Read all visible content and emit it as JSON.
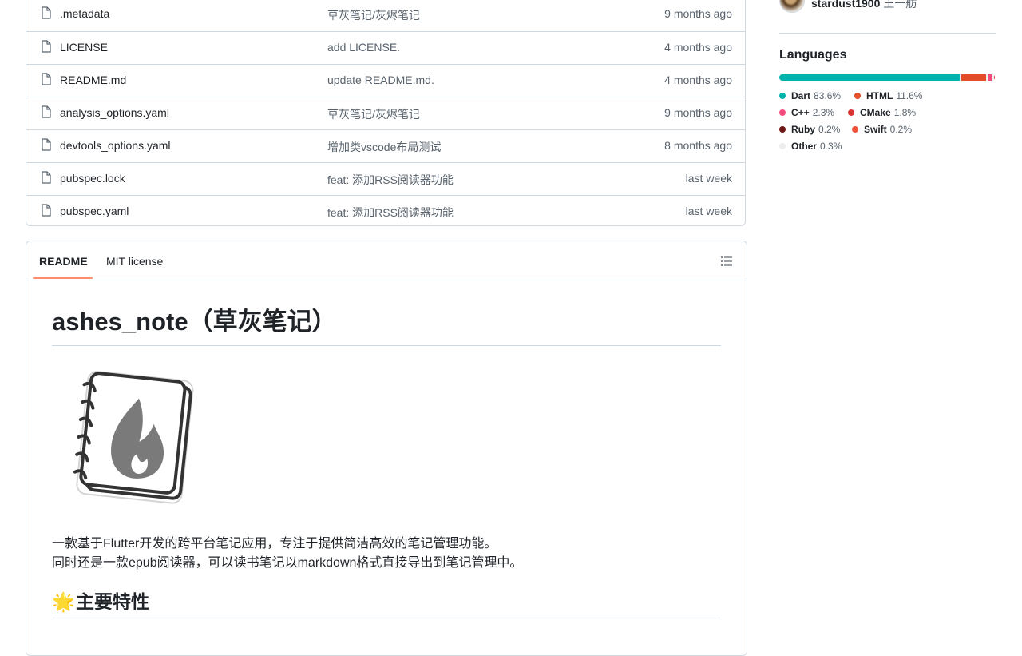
{
  "files": [
    {
      "name": ".metadata",
      "commit": "草灰笔记/灰烬笔记",
      "time": "9 months ago"
    },
    {
      "name": "LICENSE",
      "commit": "add LICENSE.",
      "time": "4 months ago"
    },
    {
      "name": "README.md",
      "commit": "update README.md.",
      "time": "4 months ago"
    },
    {
      "name": "analysis_options.yaml",
      "commit": "草灰笔记/灰烬笔记",
      "time": "9 months ago"
    },
    {
      "name": "devtools_options.yaml",
      "commit": "增加类vscode布局测试",
      "time": "8 months ago"
    },
    {
      "name": "pubspec.lock",
      "commit": "feat: 添加RSS阅读器功能",
      "time": "last week"
    },
    {
      "name": "pubspec.yaml",
      "commit": "feat: 添加RSS阅读器功能",
      "time": "last week"
    }
  ],
  "readme": {
    "tabs": {
      "readme": "README",
      "license": "MIT license"
    },
    "title": "ashes_note（草灰笔记）",
    "paragraphs": [
      "一款基于Flutter开发的跨平台笔记应用，专注于提供简洁高效的笔记管理功能。",
      "同时还是一款epub阅读器，可以读书笔记以markdown格式直接导出到笔记管理中。"
    ],
    "section_heading": "主要特性",
    "section_emoji": "🌟"
  },
  "sidebar": {
    "contributor_name": "stardust1900",
    "contributor_sub": "王一舫",
    "languages_heading": "Languages",
    "languages": [
      {
        "name": "Dart",
        "pct": "83.6%",
        "color": "#00B4AB",
        "value": 83.6
      },
      {
        "name": "HTML",
        "pct": "11.6%",
        "color": "#e34c26",
        "value": 11.6
      },
      {
        "name": "C++",
        "pct": "2.3%",
        "color": "#f34b7d",
        "value": 2.3
      },
      {
        "name": "CMake",
        "pct": "1.8%",
        "color": "#DA3434",
        "value": 1.8
      },
      {
        "name": "Ruby",
        "pct": "0.2%",
        "color": "#701516",
        "value": 0.2
      },
      {
        "name": "Swift",
        "pct": "0.2%",
        "color": "#F05138",
        "value": 0.2
      },
      {
        "name": "Other",
        "pct": "0.3%",
        "color": "#ededed",
        "value": 0.3
      }
    ]
  }
}
